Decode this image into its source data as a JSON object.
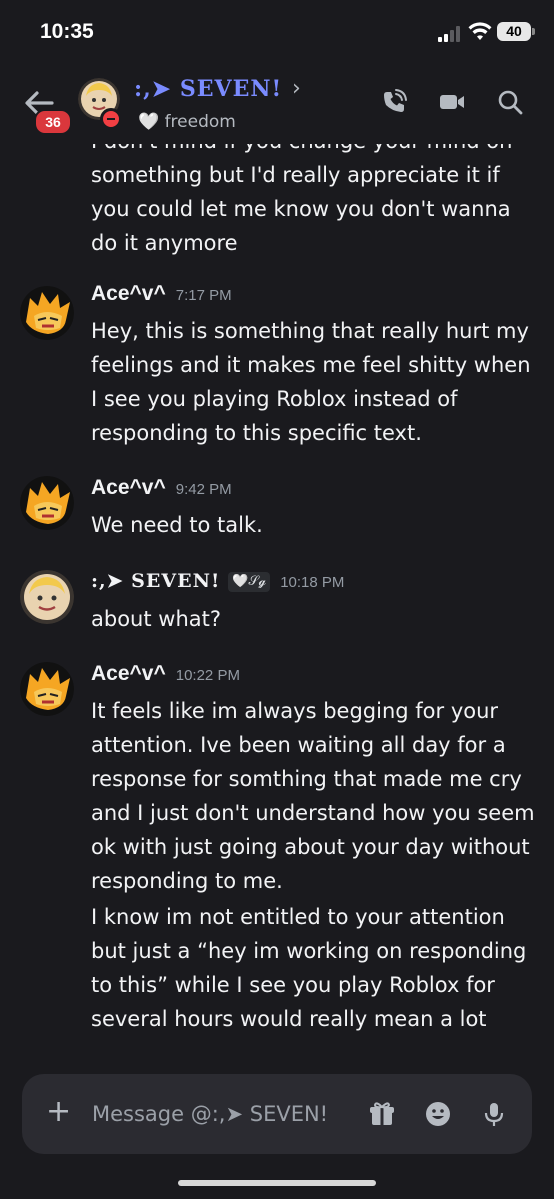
{
  "status_bar": {
    "time": "10:35",
    "battery": "40"
  },
  "header": {
    "name": ":,➤ SEVEN!",
    "status": "🤍 freedom",
    "unread_count": "36"
  },
  "messages": {
    "continued_text": "I don't mind if you change your mind on something but I'd really appreciate it if you could let me know you don't wanna do it anymore",
    "items": [
      {
        "author": "Ace^v^",
        "time": "7:17 PM",
        "text": "Hey, this is something that really hurt my feelings and it makes me feel shitty when I see you playing Roblox instead of responding to this specific text."
      },
      {
        "author": "Ace^v^",
        "time": "9:42 PM",
        "text": "We need to talk."
      },
      {
        "author": ":,➤ SEVEN!",
        "role": "🤍𝒮𝓰",
        "time": "10:18 PM",
        "text": "about what?"
      },
      {
        "author": "Ace^v^",
        "time": "10:22 PM",
        "text": "It feels like im always begging for your attention. Ive been waiting all day for a response for somthing that made me cry and I just don't understand how you seem ok with just going about your day without responding to me.",
        "text2": "I know im not entitled to your attention but just a “hey im working on responding to this” while I see you play Roblox for several hours would really mean a lot"
      }
    ]
  },
  "composer": {
    "placeholder": "Message @:,➤ SEVEN!"
  },
  "colors": {
    "background": "#1a1a1e",
    "accent_name": "#7a8bff",
    "badge": "#da373c",
    "dnd": "#f23f43"
  }
}
